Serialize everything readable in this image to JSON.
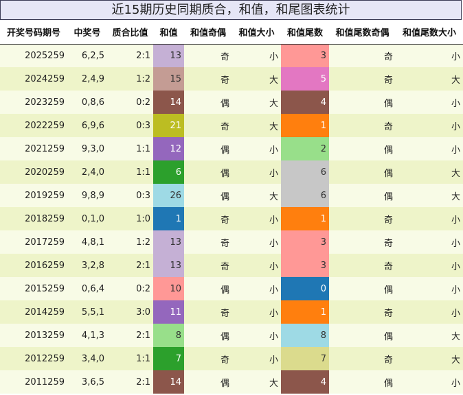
{
  "title": "近15期历史同期质合，和值，和尾图表统计",
  "headers": [
    "开奖号码期号",
    "中奖号",
    "质合比值",
    "和值",
    "和值奇偶",
    "和值大小",
    "和值尾数",
    "和值尾数奇偶",
    "和值尾数大小"
  ],
  "colors": {
    "c0": "#1f77b4",
    "c1": "#ff7f0e",
    "c2": "#2ca02c",
    "c3": "#ff9896",
    "c4": "#98df8a",
    "c5": "#e377c2",
    "c6": "#8c564b",
    "c7": "#dbdb8d",
    "c8": "#9edae5",
    "c9": "#9467bd",
    "c10": "#c5b0d5",
    "c11": "#c49c94",
    "c12": "#bcbd22",
    "c13": "#c7c7c7"
  },
  "rows": [
    {
      "issue": "2025259",
      "number": "6,2,5",
      "ratio": "2:1",
      "sum": "13",
      "sum_color": "#c5b0d5",
      "sum_parity": "奇",
      "sum_size": "小",
      "tail": "3",
      "tail_color": "#ff9896",
      "tail_parity": "奇",
      "tail_size": "小"
    },
    {
      "issue": "2024259",
      "number": "2,4,9",
      "ratio": "1:2",
      "sum": "15",
      "sum_color": "#c49c94",
      "sum_parity": "奇",
      "sum_size": "大",
      "tail": "5",
      "tail_color": "#e377c2",
      "tail_parity": "奇",
      "tail_size": "大"
    },
    {
      "issue": "2023259",
      "number": "0,8,6",
      "ratio": "0:2",
      "sum": "14",
      "sum_color": "#8c564b",
      "sum_parity": "偶",
      "sum_size": "大",
      "tail": "4",
      "tail_color": "#8c564b",
      "tail_parity": "偶",
      "tail_size": "小"
    },
    {
      "issue": "2022259",
      "number": "6,9,6",
      "ratio": "0:3",
      "sum": "21",
      "sum_color": "#bcbd22",
      "sum_parity": "奇",
      "sum_size": "大",
      "tail": "1",
      "tail_color": "#ff7f0e",
      "tail_parity": "奇",
      "tail_size": "小"
    },
    {
      "issue": "2021259",
      "number": "9,3,0",
      "ratio": "1:1",
      "sum": "12",
      "sum_color": "#9467bd",
      "sum_parity": "偶",
      "sum_size": "小",
      "tail": "2",
      "tail_color": "#98df8a",
      "tail_parity": "偶",
      "tail_size": "小"
    },
    {
      "issue": "2020259",
      "number": "2,4,0",
      "ratio": "1:1",
      "sum": "6",
      "sum_color": "#2ca02c",
      "sum_parity": "偶",
      "sum_size": "小",
      "tail": "6",
      "tail_color": "#c7c7c7",
      "tail_parity": "偶",
      "tail_size": "大"
    },
    {
      "issue": "2019259",
      "number": "9,8,9",
      "ratio": "0:3",
      "sum": "26",
      "sum_color": "#9edae5",
      "sum_parity": "偶",
      "sum_size": "大",
      "tail": "6",
      "tail_color": "#c7c7c7",
      "tail_parity": "偶",
      "tail_size": "大"
    },
    {
      "issue": "2018259",
      "number": "0,1,0",
      "ratio": "1:0",
      "sum": "1",
      "sum_color": "#1f77b4",
      "sum_parity": "奇",
      "sum_size": "小",
      "tail": "1",
      "tail_color": "#ff7f0e",
      "tail_parity": "奇",
      "tail_size": "小"
    },
    {
      "issue": "2017259",
      "number": "4,8,1",
      "ratio": "1:2",
      "sum": "13",
      "sum_color": "#c5b0d5",
      "sum_parity": "奇",
      "sum_size": "小",
      "tail": "3",
      "tail_color": "#ff9896",
      "tail_parity": "奇",
      "tail_size": "小"
    },
    {
      "issue": "2016259",
      "number": "3,2,8",
      "ratio": "2:1",
      "sum": "13",
      "sum_color": "#c5b0d5",
      "sum_parity": "奇",
      "sum_size": "小",
      "tail": "3",
      "tail_color": "#ff9896",
      "tail_parity": "奇",
      "tail_size": "小"
    },
    {
      "issue": "2015259",
      "number": "0,6,4",
      "ratio": "0:2",
      "sum": "10",
      "sum_color": "#ff9896",
      "sum_parity": "偶",
      "sum_size": "小",
      "tail": "0",
      "tail_color": "#1f77b4",
      "tail_parity": "偶",
      "tail_size": "小"
    },
    {
      "issue": "2014259",
      "number": "5,5,1",
      "ratio": "3:0",
      "sum": "11",
      "sum_color": "#9467bd",
      "sum_parity": "奇",
      "sum_size": "小",
      "tail": "1",
      "tail_color": "#ff7f0e",
      "tail_parity": "奇",
      "tail_size": "小"
    },
    {
      "issue": "2013259",
      "number": "4,1,3",
      "ratio": "2:1",
      "sum": "8",
      "sum_color": "#98df8a",
      "sum_parity": "偶",
      "sum_size": "小",
      "tail": "8",
      "tail_color": "#9edae5",
      "tail_parity": "偶",
      "tail_size": "大"
    },
    {
      "issue": "2012259",
      "number": "3,4,0",
      "ratio": "1:1",
      "sum": "7",
      "sum_color": "#2ca02c",
      "sum_parity": "奇",
      "sum_size": "小",
      "tail": "7",
      "tail_color": "#dbdb8d",
      "tail_parity": "奇",
      "tail_size": "大"
    },
    {
      "issue": "2011259",
      "number": "3,6,5",
      "ratio": "2:1",
      "sum": "14",
      "sum_color": "#8c564b",
      "sum_parity": "偶",
      "sum_size": "大",
      "tail": "4",
      "tail_color": "#8c564b",
      "tail_parity": "偶",
      "tail_size": "小"
    }
  ]
}
